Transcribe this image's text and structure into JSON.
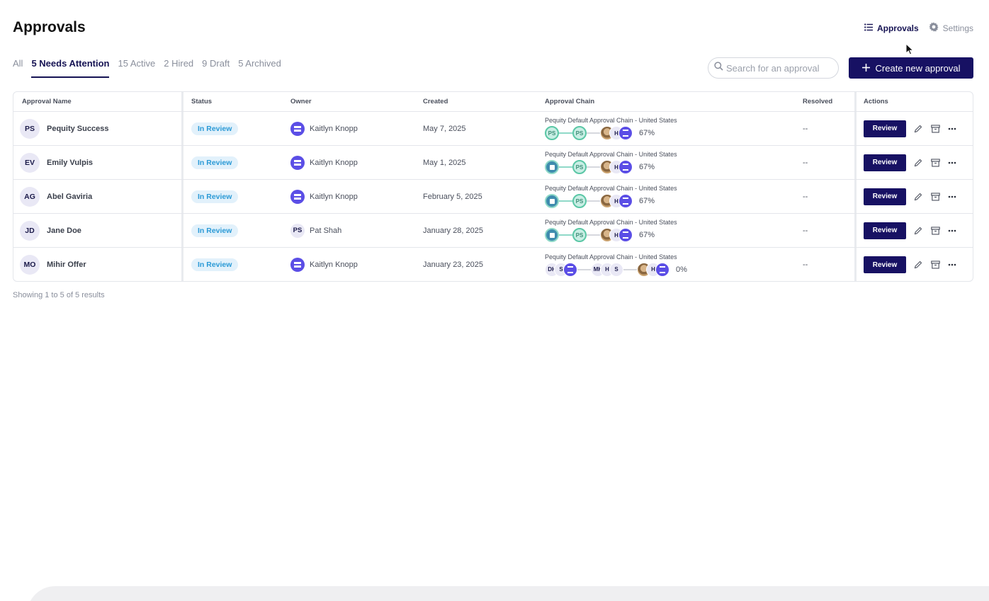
{
  "page": {
    "title": "Approvals"
  },
  "top_nav": {
    "approvals_label": "Approvals",
    "settings_label": "Settings"
  },
  "tabs": [
    {
      "label": "All",
      "active": false
    },
    {
      "label": "5 Needs Attention",
      "active": true
    },
    {
      "label": "15 Active",
      "active": false
    },
    {
      "label": "2 Hired",
      "active": false
    },
    {
      "label": "9 Draft",
      "active": false
    },
    {
      "label": "5 Archived",
      "active": false
    }
  ],
  "search": {
    "placeholder": "Search for an approval",
    "value": ""
  },
  "create_button": {
    "label": "Create new approval"
  },
  "table": {
    "columns": [
      "Approval Name",
      "Status",
      "Owner",
      "Created",
      "Approval Chain",
      "Resolved",
      "Actions"
    ],
    "rows": [
      {
        "initials": "PS",
        "name": "Pequity Success",
        "status": "In Review",
        "owner": "Kaitlyn Knopp",
        "owner_type": "brand",
        "owner_initials": "",
        "created": "May 7, 2025",
        "chain": "Pequity Default Approval Chain - United States",
        "progress": "67%",
        "resolved": "--",
        "action": "Review"
      },
      {
        "initials": "EV",
        "name": "Emily Vulpis",
        "status": "In Review",
        "owner": "Kaitlyn Knopp",
        "owner_type": "brand",
        "owner_initials": "",
        "created": "May 1, 2025",
        "chain": "Pequity Default Approval Chain - United States",
        "progress": "67%",
        "resolved": "--",
        "action": "Review"
      },
      {
        "initials": "AG",
        "name": "Abel Gaviria",
        "status": "In Review",
        "owner": "Kaitlyn Knopp",
        "owner_type": "brand",
        "owner_initials": "",
        "created": "February 5, 2025",
        "chain": "Pequity Default Approval Chain - United States",
        "progress": "67%",
        "resolved": "--",
        "action": "Review"
      },
      {
        "initials": "JD",
        "name": "Jane Doe",
        "status": "In Review",
        "owner": "Pat Shah",
        "owner_type": "initials",
        "owner_initials": "PS",
        "created": "January 28, 2025",
        "chain": "Pequity Default Approval Chain - United States",
        "progress": "67%",
        "resolved": "--",
        "action": "Review"
      },
      {
        "initials": "MO",
        "name": "Mihir Offer",
        "status": "In Review",
        "owner": "Kaitlyn Knopp",
        "owner_type": "brand",
        "owner_initials": "",
        "created": "January 23, 2025",
        "chain": "Pequity Default Approval Chain - United States",
        "progress": "0%",
        "resolved": "--",
        "action": "Review"
      }
    ],
    "chain_step_letters": {
      "h": "H",
      "dh": "DH",
      "s": "S",
      "mk": "MK"
    }
  },
  "footer": {
    "results_text": "Showing 1 to 5 of 5 results"
  },
  "colors": {
    "primary": "#171163",
    "status_bg": "#e2f1fb",
    "status_text": "#2b9ad6",
    "brand": "#5b4ee6",
    "approved": "#5bc7a6"
  },
  "icons": {
    "approvals": "list-icon",
    "settings": "gear-icon",
    "search": "search-icon",
    "create": "plus-icon",
    "edit": "pencil-icon",
    "archive": "archive-icon",
    "more": "more-icon"
  }
}
